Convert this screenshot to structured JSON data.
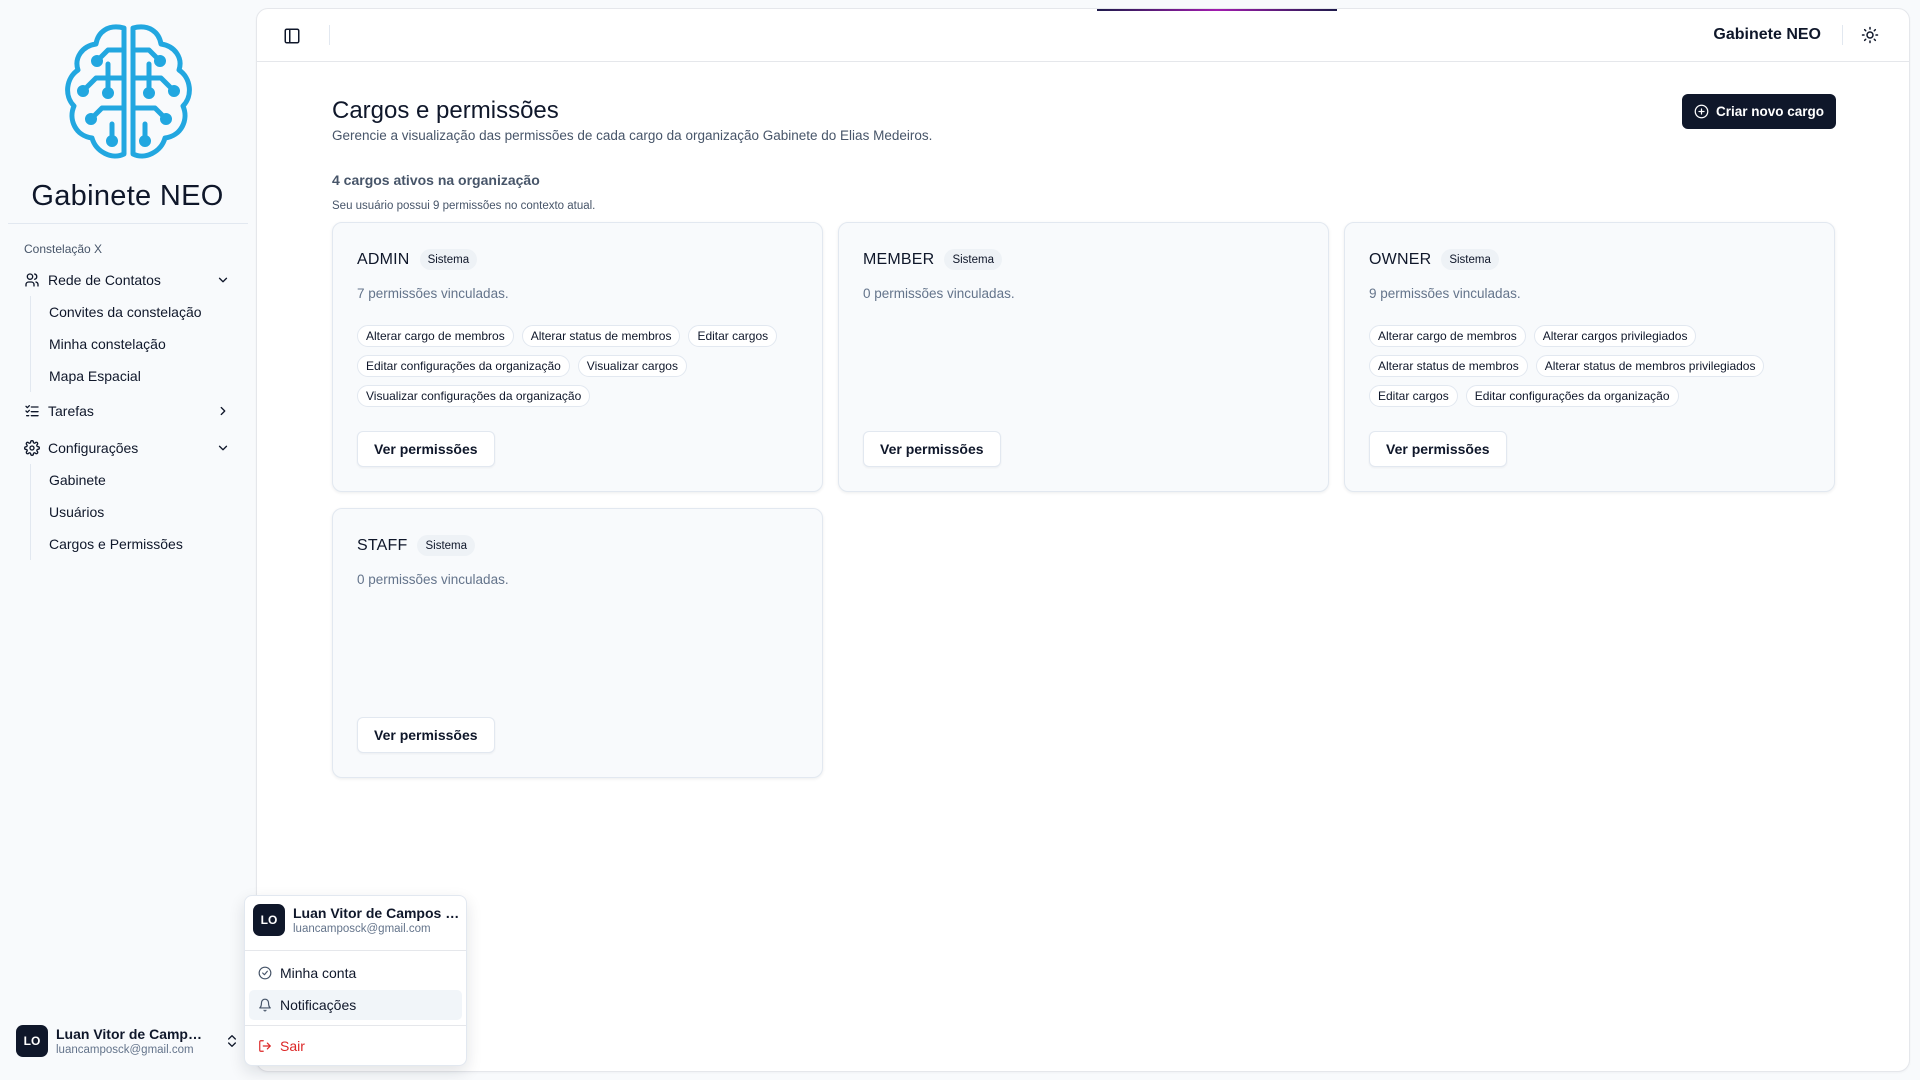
{
  "brand": {
    "name": "Gabinete NEO",
    "logo_icon": "brain-circuit-logo",
    "logo_color": "#22a7e0"
  },
  "sidebar": {
    "group_label": "Constelação X",
    "items": [
      {
        "label": "Rede de Contatos",
        "icon": "users-icon",
        "expanded": true,
        "children": [
          "Convites da constelação",
          "Minha constelação",
          "Mapa Espacial"
        ]
      },
      {
        "label": "Tarefas",
        "icon": "list-checks-icon",
        "expanded": false,
        "children": []
      },
      {
        "label": "Configurações",
        "icon": "gear-icon",
        "expanded": true,
        "children": [
          "Gabinete",
          "Usuários",
          "Cargos e Permissões"
        ]
      }
    ],
    "user": {
      "initials": "LO",
      "name": "Luan Vitor de Campos Oliveira",
      "email": "luancamposck@gmail.com"
    }
  },
  "header": {
    "title": "Gabinete NEO"
  },
  "page": {
    "title": "Cargos e permissões",
    "subtitle": "Gerencie a visualização das permissões de cada cargo da organização Gabinete do Elias Medeiros.",
    "create_button": "Criar novo cargo",
    "count_title": "4 cargos ativos na organização",
    "count_subtitle": "Seu usuário possui 9 permissões no contexto atual."
  },
  "roles": [
    {
      "name": "ADMIN",
      "badge": "Sistema",
      "description": "7 permissões vinculadas.",
      "permissions": [
        "Alterar cargo de membros",
        "Alterar status de membros",
        "Editar cargos",
        "Editar configurações da organização",
        "Visualizar cargos",
        "Visualizar configurações da organização"
      ],
      "button": "Ver permissões"
    },
    {
      "name": "MEMBER",
      "badge": "Sistema",
      "description": "0 permissões vinculadas.",
      "permissions": [],
      "button": "Ver permissões"
    },
    {
      "name": "OWNER",
      "badge": "Sistema",
      "description": "9 permissões vinculadas.",
      "permissions": [
        "Alterar cargo de membros",
        "Alterar cargos privilegiados",
        "Alterar status de membros",
        "Alterar status de membros privilegiados",
        "Editar cargos",
        "Editar configurações da organização"
      ],
      "button": "Ver permissões"
    },
    {
      "name": "STAFF",
      "badge": "Sistema",
      "description": "0 permissões vinculadas.",
      "permissions": [],
      "button": "Ver permissões"
    }
  ],
  "user_menu": {
    "initials": "LO",
    "name": "Luan Vitor de Campos Oliveira",
    "email": "luancamposck@gmail.com",
    "items": [
      {
        "label": "Minha conta",
        "icon": "badge-check-icon"
      },
      {
        "label": "Notificações",
        "icon": "bell-icon"
      },
      {
        "label": "Sair",
        "icon": "logout-icon"
      }
    ]
  }
}
